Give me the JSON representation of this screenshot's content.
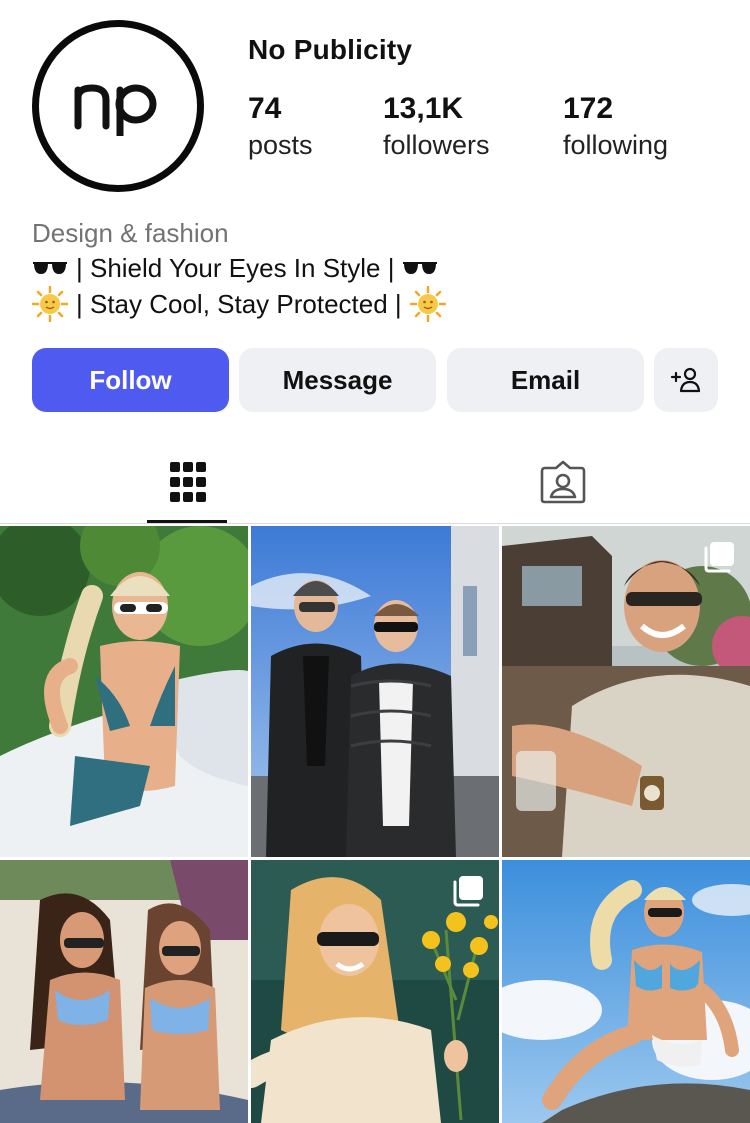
{
  "profile": {
    "username": "No Publicity",
    "avatar_monogram": "np",
    "stats": {
      "posts": {
        "value": "74",
        "label": "posts"
      },
      "followers": {
        "value": "13,1K",
        "label": "followers"
      },
      "following": {
        "value": "172",
        "label": "following"
      }
    },
    "category": "Design & fashion",
    "bio_lines": [
      {
        "icon": "sunglasses-emoji",
        "text": "| Shield Your Eyes In Style |"
      },
      {
        "icon": "sun-emoji",
        "text": "| Stay Cool, Stay Protected |"
      }
    ]
  },
  "actions": {
    "follow": "Follow",
    "message": "Message",
    "email": "Email",
    "add_user_icon": "add-user-icon"
  },
  "tabs": {
    "active": "grid",
    "items": [
      {
        "name": "posts-grid",
        "icon": "grid-icon"
      },
      {
        "name": "tagged",
        "icon": "tagged-person-icon"
      }
    ]
  },
  "colors": {
    "follow_button": "#4f5bf0",
    "secondary_button": "#eff0f3",
    "category_text": "#737373"
  },
  "posts": [
    {
      "id": "post-1",
      "subject": "woman in blue bikini with white sunglasses",
      "multi": false
    },
    {
      "id": "post-2",
      "subject": "two men in puffer jackets wearing sunglasses",
      "multi": false
    },
    {
      "id": "post-3",
      "subject": "smiling man in sunglasses with drink",
      "multi": true
    },
    {
      "id": "post-4",
      "subject": "two women in blue bikinis on beach",
      "multi": false
    },
    {
      "id": "post-5",
      "subject": "woman with sunglasses holding yellow flowers",
      "multi": true
    },
    {
      "id": "post-6",
      "subject": "woman in blue bikini on rock with sky",
      "multi": false
    }
  ]
}
